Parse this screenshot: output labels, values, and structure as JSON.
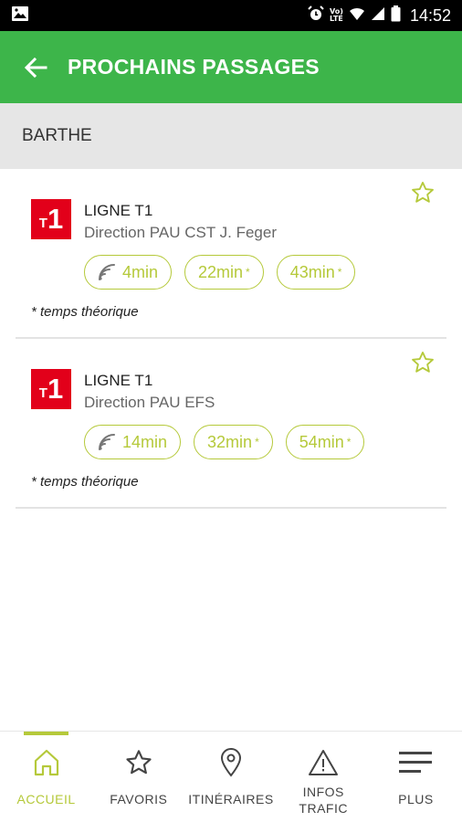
{
  "status_bar": {
    "time": "14:52",
    "battery_label": ""
  },
  "app_bar": {
    "title": "PROCHAINS PASSAGES"
  },
  "stop": {
    "name": "BARTHE"
  },
  "passages": [
    {
      "line_badge": "1",
      "line_badge_prefix": "T",
      "line_name": "LIGNE T1",
      "direction": "Direction PAU CST J. Feger",
      "times": [
        {
          "value": "4min",
          "realtime": true,
          "theoretical_mark": ""
        },
        {
          "value": "22min",
          "realtime": false,
          "theoretical_mark": "*"
        },
        {
          "value": "43min",
          "realtime": false,
          "theoretical_mark": "*"
        }
      ],
      "note": "* temps théorique"
    },
    {
      "line_badge": "1",
      "line_badge_prefix": "T",
      "line_name": "LIGNE T1",
      "direction": "Direction PAU EFS",
      "times": [
        {
          "value": "14min",
          "realtime": true,
          "theoretical_mark": ""
        },
        {
          "value": "32min",
          "realtime": false,
          "theoretical_mark": "*"
        },
        {
          "value": "54min",
          "realtime": false,
          "theoretical_mark": "*"
        }
      ],
      "note": "* temps théorique"
    }
  ],
  "bottom_nav": {
    "items": [
      {
        "label": "ACCUEIL",
        "icon": "home-icon",
        "active": true
      },
      {
        "label": "FAVORIS",
        "icon": "star-icon",
        "active": false
      },
      {
        "label": "ITINÉRAIRES",
        "icon": "location-pin-icon",
        "active": false
      },
      {
        "label": "INFOS\nTRAFIC",
        "label_line1": "INFOS",
        "label_line2": "TRAFIC",
        "icon": "warning-icon",
        "active": false
      },
      {
        "label": "PLUS",
        "icon": "menu-icon",
        "active": false
      }
    ]
  },
  "colors": {
    "primary_green": "#3db54a",
    "accent_lime": "#b5c93a",
    "line_red": "#e2001a",
    "header_grey": "#e6e6e6"
  }
}
